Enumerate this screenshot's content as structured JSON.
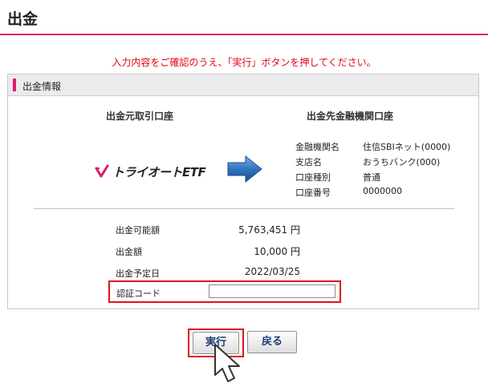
{
  "header": {
    "title": "出金"
  },
  "instruction": "入力内容をご確認のうえ、「実行」ボタンを押してください。",
  "panel": {
    "title": "出金情報",
    "source_heading": "出金元取引口座",
    "destination_heading": "出金先金融機関口座",
    "brand": {
      "name": "トライオートETF",
      "icon": "brand-check-mark"
    },
    "transfer_icon": "arrow-right-icon",
    "bank": [
      {
        "label": "金融機関名",
        "value": "住信SBIネット(0000)"
      },
      {
        "label": "支店名",
        "value": "おうちバンク(000)"
      },
      {
        "label": "口座種別",
        "value": "普通"
      },
      {
        "label": "口座番号",
        "value": "0000000"
      }
    ],
    "summary": [
      {
        "label": "出金可能額",
        "value": "5,763,451 円"
      },
      {
        "label": "出金額",
        "value": "10,000 円"
      },
      {
        "label": "出金予定日",
        "value": "2022/03/25"
      }
    ],
    "auth_code": {
      "label": "認証コード",
      "value": "",
      "placeholder": ""
    }
  },
  "buttons": {
    "execute": "実行",
    "back": "戻る"
  },
  "colors": {
    "accent": "#e2186f",
    "alert": "#e60012",
    "highlight": "#e0121b",
    "button_text": "#1d3c74",
    "arrow": "#2f74c0"
  }
}
